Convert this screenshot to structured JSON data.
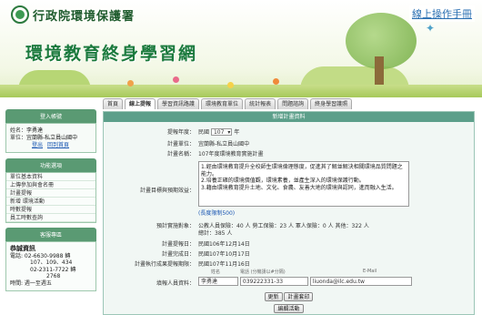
{
  "header": {
    "agency": "行政院環境保護署",
    "site_title": "環境教育終身學習網",
    "manual_link": "線上操作手冊"
  },
  "tabs": [
    "首頁",
    "線上提報",
    "學習資訊路護",
    "環境教育單位",
    "統計報表",
    "問題諮詢",
    "終身學習護照"
  ],
  "active_tab": 1,
  "sidebar": {
    "login_title": "登入帳號",
    "name_label": "姓名：",
    "name_value": "李勇達",
    "unit_label": "單位：",
    "unit_value": "宜蘭縣-私立員山國中",
    "logout": "登出",
    "change_password": "回到首頁",
    "function_title": "功能選項",
    "menu": [
      "單位基本資料",
      "上傳參加與會名冊",
      "計畫提報",
      "新增 環境活動",
      "時數提報",
      "員工時數查詢"
    ],
    "contact_title": "客服專區",
    "contact_org": "恭誠資訊",
    "contact_lines": [
      "電話: 02-6630-9988 轉",
      "107、109、434",
      "02-2311-7722 轉",
      "2768",
      "時間: 週一至週五"
    ]
  },
  "form": {
    "title": "新增計畫資料",
    "year_label": "提報年度：",
    "year_prefix": "民國",
    "year_value": "107",
    "year_suffix": "年",
    "unit_label": "計畫單位：",
    "unit_value": "宜蘭縣-私立員山國中",
    "name_label": "計畫名稱：",
    "name_value": "107年度環境教育實施計畫",
    "goal_label": "計畫目標與預期效益：",
    "goal_lines": [
      "1.經由環境教育提升全校師生環境倫理態度，促進其了解並解決相關環境品質問題之能力。",
      "2.培養正確的環境價值觀，環境素養，並產生深入的環境保護行動。",
      "3.藉由環境教育提升土地、文化、食農、友善大地的環境與認同，進而融入生活。"
    ],
    "limit_text": "(長度限制500)",
    "people_label": "預計實施對象：",
    "people_line1": "公教人員保險：40 人  勞工保險：23 人  軍人保險：0 人  其他：322 人",
    "people_line2": "總計：385 人",
    "submit_date_label": "計畫提報日：",
    "submit_date_value": "民國106年12月14日",
    "finish_date_label": "計畫完成日：",
    "finish_date_value": "民國107年10月17日",
    "exec_date_label": "計畫執行成果提報期限：",
    "exec_date_value": "民國107年11月16日",
    "contact_label": "填報人員資料：",
    "col_name": "姓名",
    "col_phone": "電話 (分機請以#分隔)",
    "col_email": "E-Mail",
    "contact_name": "李勇達",
    "contact_phone": "039222331-33",
    "contact_email": "liuonda@ilc.edu.tw",
    "btn_update": "更新",
    "btn_print": "計畫套印",
    "btn_activity": "編輯活動"
  }
}
